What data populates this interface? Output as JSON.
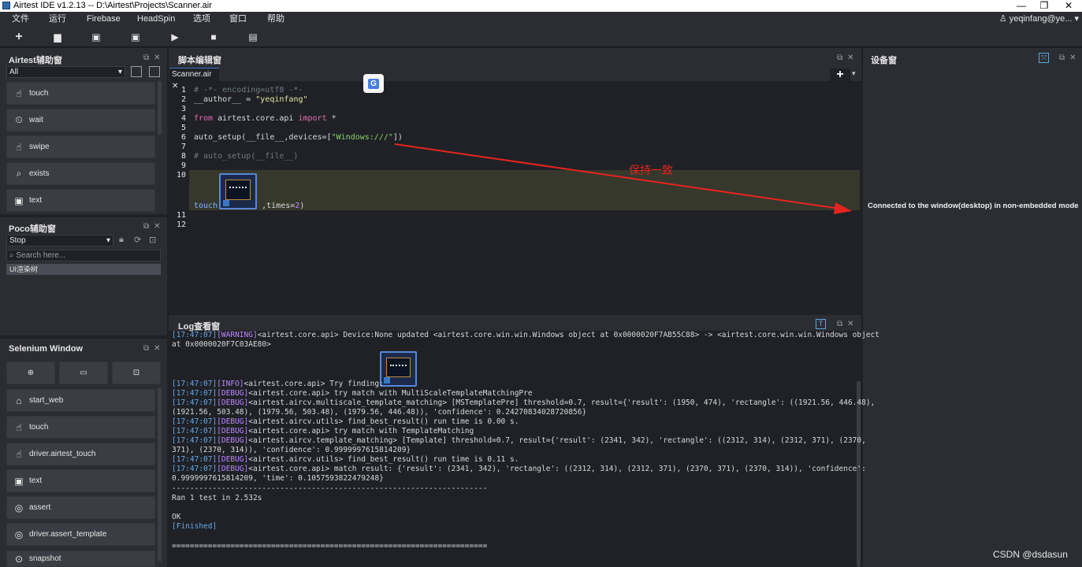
{
  "window": {
    "title": "Airtest IDE v1.2.13 -- D:\\Airtest\\Projects\\Scanner.air",
    "min": "—",
    "max": "❐",
    "close": "✕"
  },
  "menu": [
    "文件",
    "运行",
    "Firebase",
    "HeadSpin",
    "选项",
    "窗口",
    "帮助"
  ],
  "user": "yeqinfang@ye...",
  "toolbar": [
    "+",
    "▆",
    "▣",
    "▣",
    "▶",
    "■",
    "▤"
  ],
  "airtest_panel": {
    "title": "Airtest辅助窗",
    "filter": "All",
    "buttons": [
      {
        "icon": "☝",
        "label": "touch"
      },
      {
        "icon": "⏲",
        "label": "wait"
      },
      {
        "icon": "☝",
        "label": "swipe"
      },
      {
        "icon": "⌕",
        "label": "exists"
      },
      {
        "icon": "▣",
        "label": "text"
      }
    ]
  },
  "poco_panel": {
    "title": "Poco辅助窗",
    "mode": "Stop",
    "search_placeholder": "Search here...",
    "tree_item": "UI渲染树"
  },
  "selenium_panel": {
    "title": "Selenium Window",
    "top_icons": [
      "⊕",
      "▭",
      "⊡"
    ],
    "buttons": [
      {
        "icon": "⌂",
        "label": "start_web"
      },
      {
        "icon": "☝",
        "label": "touch"
      },
      {
        "icon": "☝",
        "label": "driver.airtest_touch"
      },
      {
        "icon": "▣",
        "label": "text"
      },
      {
        "icon": "◎",
        "label": "assert"
      },
      {
        "icon": "◎",
        "label": "driver.assert_template"
      },
      {
        "icon": "⊙",
        "label": "snapshot"
      }
    ]
  },
  "editor": {
    "title": "脚本编辑窗",
    "tab": "Scanner.air ✕",
    "lines": [
      "1",
      "2",
      "3",
      "4",
      "5",
      "6",
      "7",
      "8",
      "9",
      "10",
      "11",
      "12"
    ],
    "code": {
      "l1": "# -*- encoding=utf8 -*-",
      "l2a": "__author__ = ",
      "l2b": "\"yeqinfang\"",
      "l4a": "from",
      "l4b": " airtest.core.api ",
      "l4c": "import",
      "l4d": " *",
      "l6a": "auto_setup(__file__,devices=[",
      "l6b": "\"Windows:///\"",
      "l6c": "])",
      "l8": "# auto_setup(__file__)",
      "l10a": "touch(",
      "l10b": ",times=",
      "l10c": "2",
      "l10d": ")"
    }
  },
  "annotation": "保持一致",
  "device_panel": {
    "title": "设备窗",
    "message": "Connected to the window(desktop) in non-embedded mode"
  },
  "log_panel": {
    "title": "Log查看窗",
    "lines": [
      {
        "ts": "[17:47:07]",
        "lv": "[WARNING]",
        "text": "<airtest.core.api> Device:None updated <airtest.core.win.win.Windows object at 0x0000020F7AB55C88> -> <airtest.core.win.win.Windows object"
      },
      {
        "ts": "",
        "lv": "",
        "text": "at 0x0000020F7C03AE80>"
      },
      {
        "ts": "[17:47:07]",
        "lv": "[INFO]",
        "text": "<airtest.core.api> Try finding:"
      },
      {
        "ts": "[17:47:07]",
        "lv": "[DEBUG]",
        "text": "<airtest.core.api> try match with MultiScaleTemplateMatchingPre"
      },
      {
        "ts": "[17:47:07]",
        "lv": "[DEBUG]",
        "text": "<airtest.aircv.multiscale_template_matching> [MSTemplatePre] threshold=0.7, result={'result': (1950, 474), 'rectangle': ((1921.56, 446.48),"
      },
      {
        "ts": "",
        "lv": "",
        "text": "(1921.56, 503.48), (1979.56, 503.48), (1979.56, 446.48)), 'confidence': 0.24270834028720856}"
      },
      {
        "ts": "[17:47:07]",
        "lv": "[DEBUG]",
        "text": "<airtest.aircv.utils> find_best_result() run time is 0.00 s."
      },
      {
        "ts": "[17:47:07]",
        "lv": "[DEBUG]",
        "text": "<airtest.core.api> try match with TemplateMatching"
      },
      {
        "ts": "[17:47:07]",
        "lv": "[DEBUG]",
        "text": "<airtest.aircv.template_matching> [Template] threshold=0.7, result={'result': (2341, 342), 'rectangle': ((2312, 314), (2312, 371), (2370,"
      },
      {
        "ts": "",
        "lv": "",
        "text": "371), (2370, 314)), 'confidence': 0.9999997615814209}"
      },
      {
        "ts": "[17:47:07]",
        "lv": "[DEBUG]",
        "text": "<airtest.aircv.utils> find_best_result() run time is 0.11 s."
      },
      {
        "ts": "[17:47:07]",
        "lv": "[DEBUG]",
        "text": "<airtest.core.api> match result: {'result': (2341, 342), 'rectangle': ((2312, 314), (2312, 371), (2370, 371), (2370, 314)), 'confidence':"
      },
      {
        "ts": "",
        "lv": "",
        "text": "0.9999997615814209, 'time': 0.1057593822479248}"
      },
      {
        "ts": "",
        "lv": "",
        "text": "----------------------------------------------------------------------"
      },
      {
        "ts": "",
        "lv": "",
        "text": "Ran 1 test in 2.532s"
      },
      {
        "ts": "",
        "lv": "",
        "text": ""
      },
      {
        "ts": "",
        "lv": "",
        "text": "OK"
      },
      {
        "ts": "",
        "lv": "",
        "text": "[Finished]"
      },
      {
        "ts": "",
        "lv": "",
        "text": ""
      },
      {
        "ts": "",
        "lv": "",
        "text": "======================================================================"
      }
    ]
  },
  "watermark": "CSDN @dsdasun",
  "colors": {
    "bg": "#1f2126",
    "panel": "#2b2d33",
    "arrow": "#e8231d",
    "accent": "#3b78c2"
  }
}
